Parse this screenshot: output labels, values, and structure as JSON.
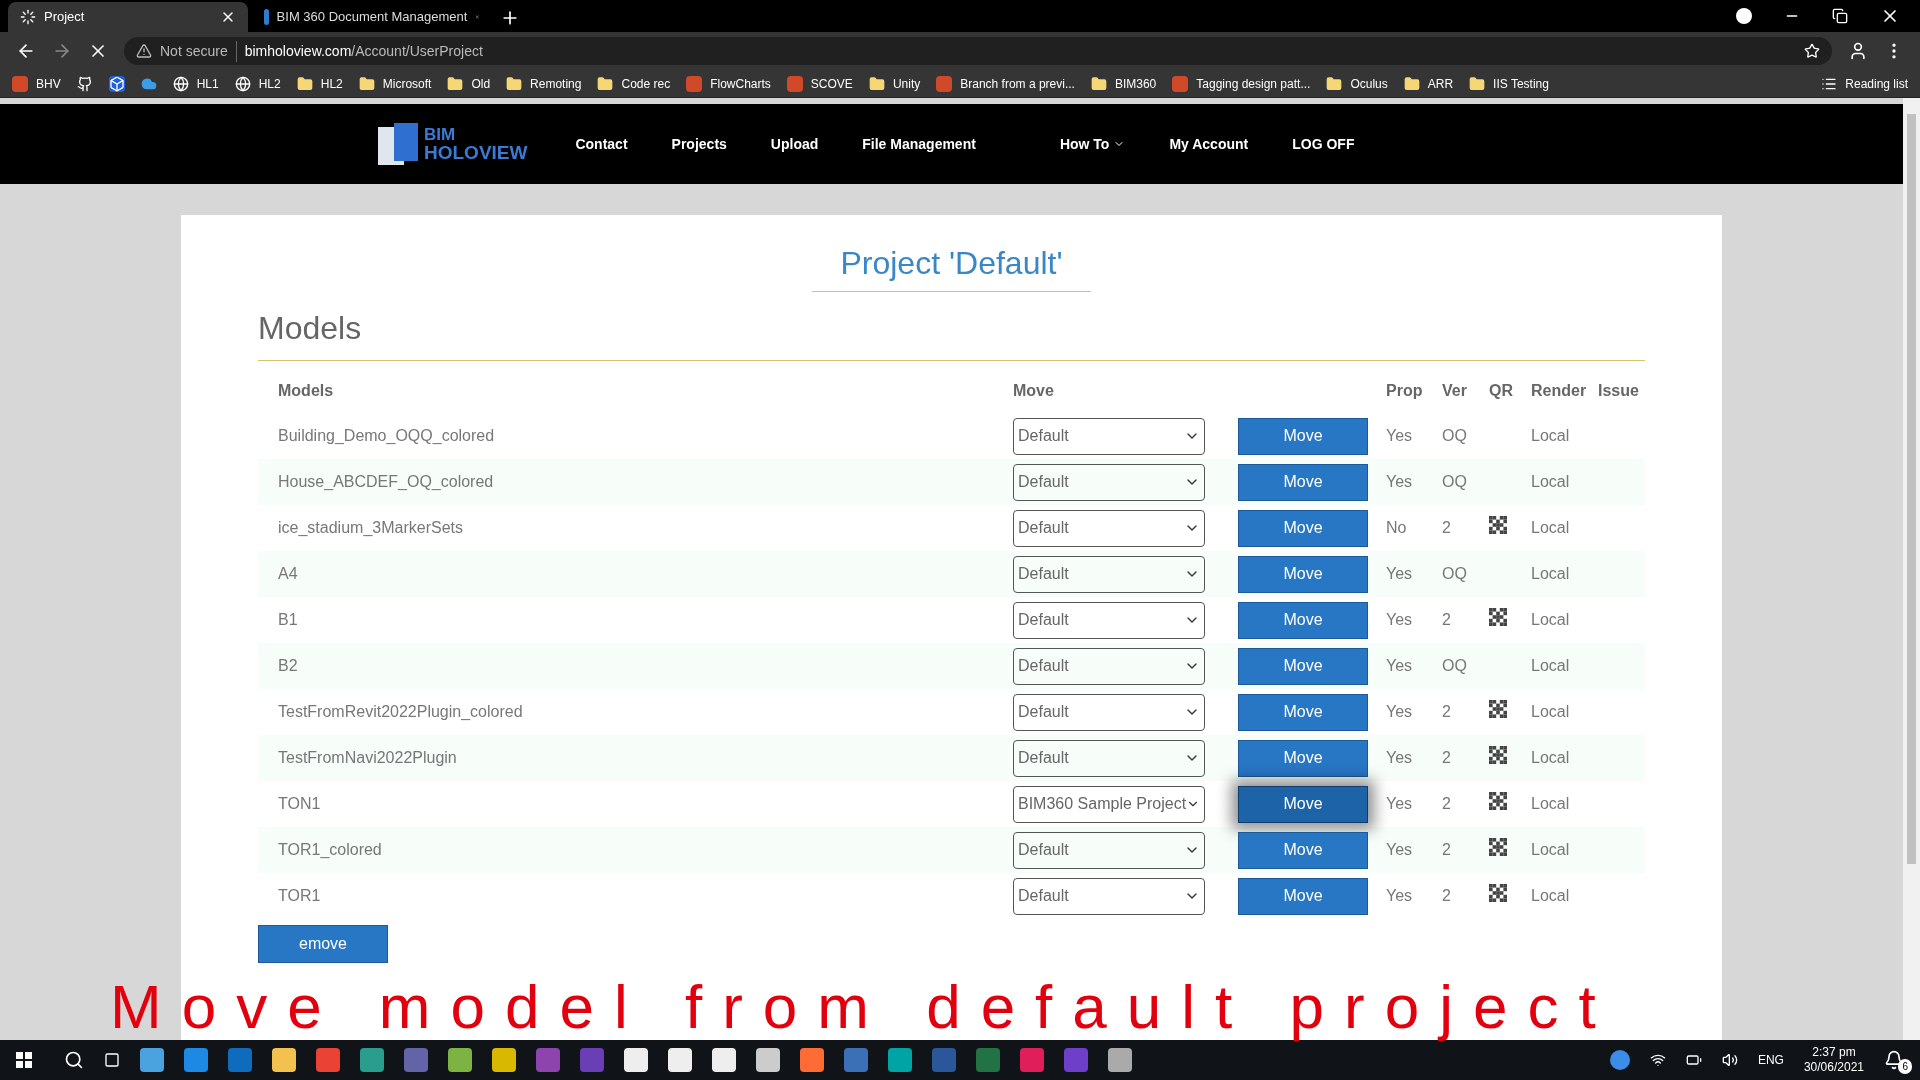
{
  "browser": {
    "tabs": [
      {
        "title": "Project",
        "selected": true,
        "loading": true
      },
      {
        "title": "BIM 360 Document Management",
        "selected": false,
        "loading": false
      }
    ],
    "security": "Not secure",
    "url_host": "bimholoview.com",
    "url_path": "/Account/UserProject",
    "bookmarks": [
      {
        "kind": "app",
        "label": "BHV"
      },
      {
        "kind": "github"
      },
      {
        "kind": "dropbox"
      },
      {
        "kind": "cloud"
      },
      {
        "kind": "globe",
        "label": "HL1"
      },
      {
        "kind": "globe",
        "label": "HL2"
      },
      {
        "kind": "folder",
        "label": "HL2"
      },
      {
        "kind": "folder",
        "label": "Microsoft"
      },
      {
        "kind": "folder",
        "label": "Old"
      },
      {
        "kind": "folder",
        "label": "Remoting"
      },
      {
        "kind": "folder",
        "label": "Code rec"
      },
      {
        "kind": "app",
        "label": "FlowCharts"
      },
      {
        "kind": "app",
        "label": "SCOVE"
      },
      {
        "kind": "folder",
        "label": "Unity"
      },
      {
        "kind": "app",
        "label": "Branch from a previ..."
      },
      {
        "kind": "folder",
        "label": "BIM360"
      },
      {
        "kind": "app",
        "label": "Tagging design patt..."
      },
      {
        "kind": "folder",
        "label": "Oculus"
      },
      {
        "kind": "folder",
        "label": "ARR"
      },
      {
        "kind": "folder",
        "label": "IIS Testing"
      }
    ],
    "reading_list": "Reading list"
  },
  "site_nav": {
    "logo_top": "BIM",
    "logo_bottom": "HOLOVIEW",
    "links": [
      {
        "label": "Contact",
        "dropdown": false
      },
      {
        "label": "Projects",
        "dropdown": false
      },
      {
        "label": "Upload",
        "dropdown": false
      },
      {
        "label": "File Management",
        "dropdown": false
      },
      {
        "label": "How To",
        "dropdown": true
      },
      {
        "label": "My Account",
        "dropdown": false
      },
      {
        "label": "LOG OFF",
        "dropdown": false
      }
    ]
  },
  "page": {
    "title": "Project 'Default'",
    "section": "Models",
    "columns": [
      "Models",
      "Move",
      "Prop",
      "Ver",
      "QR",
      "Render",
      "Issue"
    ],
    "rows": [
      {
        "name": "Building_Demo_OQQ_colored",
        "target": "Default",
        "button": "Move",
        "hovered": false,
        "prop": "Yes",
        "ver": "OQ",
        "qr": false,
        "render": "Local"
      },
      {
        "name": "House_ABCDEF_OQ_colored",
        "target": "Default",
        "button": "Move",
        "hovered": false,
        "prop": "Yes",
        "ver": "OQ",
        "qr": false,
        "render": "Local"
      },
      {
        "name": "ice_stadium_3MarkerSets",
        "target": "Default",
        "button": "Move",
        "hovered": false,
        "prop": "No",
        "ver": "2",
        "qr": true,
        "render": "Local"
      },
      {
        "name": "A4",
        "target": "Default",
        "button": "Move",
        "hovered": false,
        "prop": "Yes",
        "ver": "OQ",
        "qr": false,
        "render": "Local"
      },
      {
        "name": "B1",
        "target": "Default",
        "button": "Move",
        "hovered": false,
        "prop": "Yes",
        "ver": "2",
        "qr": true,
        "render": "Local"
      },
      {
        "name": "B2",
        "target": "Default",
        "button": "Move",
        "hovered": false,
        "prop": "Yes",
        "ver": "OQ",
        "qr": false,
        "render": "Local"
      },
      {
        "name": "TestFromRevit2022Plugin_colored",
        "target": "Default",
        "button": "Move",
        "hovered": false,
        "prop": "Yes",
        "ver": "2",
        "qr": true,
        "render": "Local"
      },
      {
        "name": "TestFromNavi2022Plugin",
        "target": "Default",
        "button": "Move",
        "hovered": false,
        "prop": "Yes",
        "ver": "2",
        "qr": true,
        "render": "Local"
      },
      {
        "name": "TON1",
        "target": "BIM360 Sample Project",
        "button": "Move",
        "hovered": true,
        "prop": "Yes",
        "ver": "2",
        "qr": true,
        "render": "Local"
      },
      {
        "name": "TOR1_colored",
        "target": "Default",
        "button": "Move",
        "hovered": false,
        "prop": "Yes",
        "ver": "2",
        "qr": true,
        "render": "Local"
      },
      {
        "name": "TOR1",
        "target": "Default",
        "button": "Move",
        "hovered": false,
        "prop": "Yes",
        "ver": "2",
        "qr": true,
        "render": "Local"
      }
    ],
    "remove_button": "emove"
  },
  "caption": "Move model from default project",
  "taskbar": {
    "language": "ENG",
    "time": "2:37 pm",
    "date": "30/06/2021",
    "notifications": "6"
  }
}
